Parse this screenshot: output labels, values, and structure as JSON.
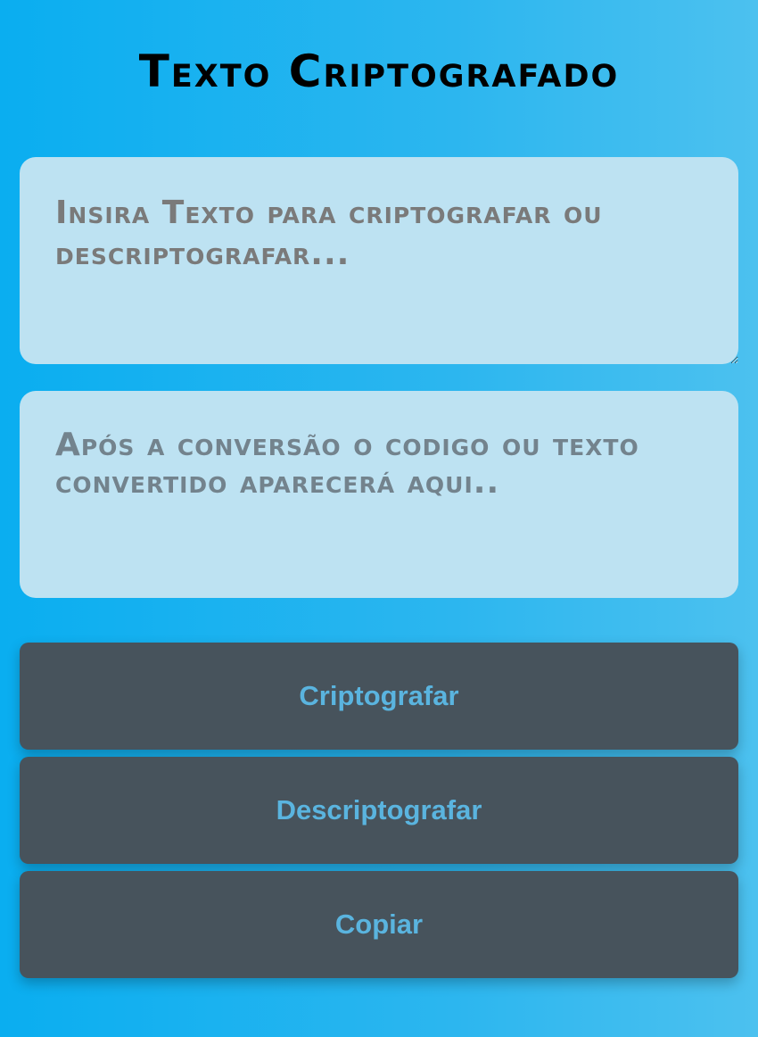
{
  "header": {
    "title": "Texto Criptografado"
  },
  "input": {
    "value": "",
    "placeholder": "Insira Texto para criptografar ou descriptografar..."
  },
  "output": {
    "text": "Após a conversão o codigo ou texto convertido aparecerá aqui.."
  },
  "buttons": {
    "encrypt_label": "Criptografar",
    "decrypt_label": "Descriptografar",
    "copy_label": "Copiar"
  },
  "colors": {
    "background_start": "#0aaef0",
    "background_end": "#4cc1ef",
    "panel": "#bde2f2",
    "button_bg": "#47535c",
    "button_text": "#5ab4df"
  }
}
